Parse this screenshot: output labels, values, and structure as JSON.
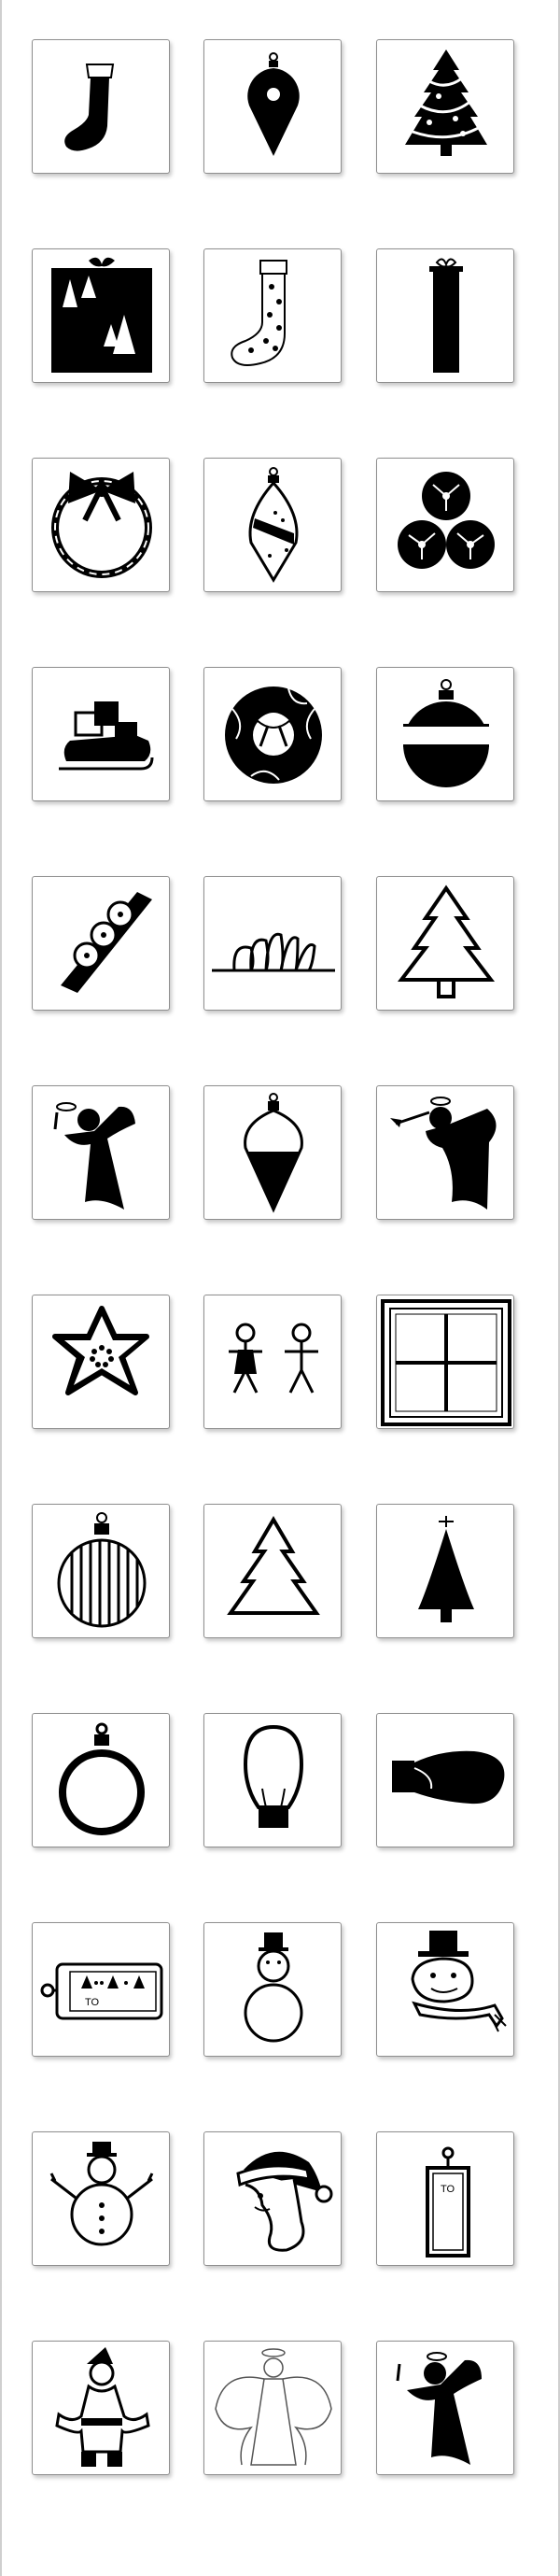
{
  "tiles": [
    {
      "icon": "christmas-stocking-icon"
    },
    {
      "icon": "teardrop-ornament-icon"
    },
    {
      "icon": "decorated-christmas-tree-icon"
    },
    {
      "icon": "gift-box-triangles-icon"
    },
    {
      "icon": "polka-dot-stocking-icon"
    },
    {
      "icon": "tall-gift-box-icon"
    },
    {
      "icon": "bow-wreath-icon"
    },
    {
      "icon": "striped-teardrop-ornament-icon"
    },
    {
      "icon": "ornament-cluster-icon"
    },
    {
      "icon": "sleigh-with-gifts-icon"
    },
    {
      "icon": "leafy-wreath-icon"
    },
    {
      "icon": "banded-ball-ornament-icon"
    },
    {
      "icon": "bell-garland-icon"
    },
    {
      "icon": "poinsettia-fan-icon"
    },
    {
      "icon": "outline-tiered-tree-icon"
    },
    {
      "icon": "angel-with-wand-icon"
    },
    {
      "icon": "finial-ornament-icon"
    },
    {
      "icon": "trumpet-angel-icon"
    },
    {
      "icon": "star-cookie-icon"
    },
    {
      "icon": "gingerbread-couple-icon"
    },
    {
      "icon": "frosted-window-icon"
    },
    {
      "icon": "striped-ball-ornament-icon"
    },
    {
      "icon": "outline-pine-tree-icon"
    },
    {
      "icon": "solid-tree-with-star-icon"
    },
    {
      "icon": "ring-ornament-icon"
    },
    {
      "icon": "light-bulb-icon"
    },
    {
      "icon": "sideways-light-bulb-icon"
    },
    {
      "icon": "gift-tag-trees-icon"
    },
    {
      "icon": "snowman-top-hat-icon"
    },
    {
      "icon": "snowman-scarf-icon"
    },
    {
      "icon": "snowman-stick-arms-icon"
    },
    {
      "icon": "santa-face-icon"
    },
    {
      "icon": "vertical-gift-tag-icon"
    },
    {
      "icon": "santa-full-body-icon"
    },
    {
      "icon": "outline-angel-icon"
    },
    {
      "icon": "angel-with-wand-2-icon"
    }
  ],
  "tag_labels": {
    "horizontal_tag": "TO",
    "vertical_tag": "TO"
  }
}
